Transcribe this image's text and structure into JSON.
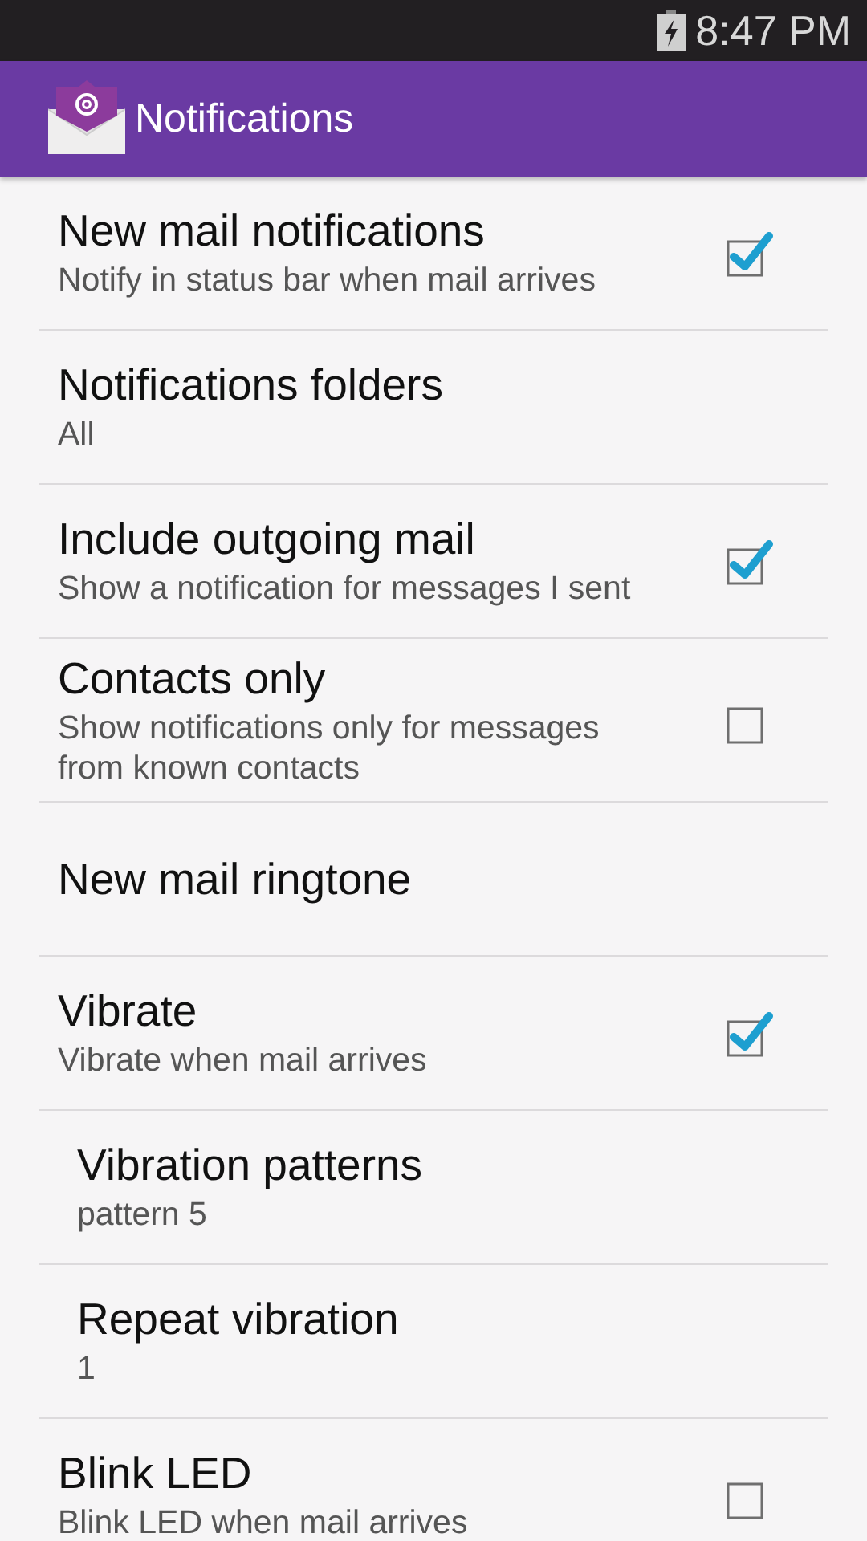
{
  "status_bar": {
    "time": "8:47 PM"
  },
  "action_bar": {
    "title": "Notifications"
  },
  "settings": [
    {
      "title": "New mail notifications",
      "summary": "Notify in status bar when mail arrives",
      "kind": "checkbox",
      "checked": true
    },
    {
      "title": "Notifications folders",
      "summary": "All",
      "kind": "plain"
    },
    {
      "title": "Include outgoing mail",
      "summary": "Show a notification for messages I sent",
      "kind": "checkbox",
      "checked": true
    },
    {
      "title": "Contacts only",
      "summary": "Show notifications only for messages from known contacts",
      "kind": "checkbox",
      "checked": false
    },
    {
      "title": "New mail ringtone",
      "kind": "plain"
    },
    {
      "title": "Vibrate",
      "summary": "Vibrate when mail arrives",
      "kind": "checkbox",
      "checked": true,
      "children": [
        {
          "title": "Vibration patterns",
          "summary": "pattern 5",
          "kind": "plain"
        },
        {
          "title": "Repeat vibration",
          "summary": "1",
          "kind": "plain"
        }
      ]
    },
    {
      "title": "Blink LED",
      "summary": "Blink LED when mail arrives",
      "kind": "checkbox",
      "checked": false
    }
  ]
}
